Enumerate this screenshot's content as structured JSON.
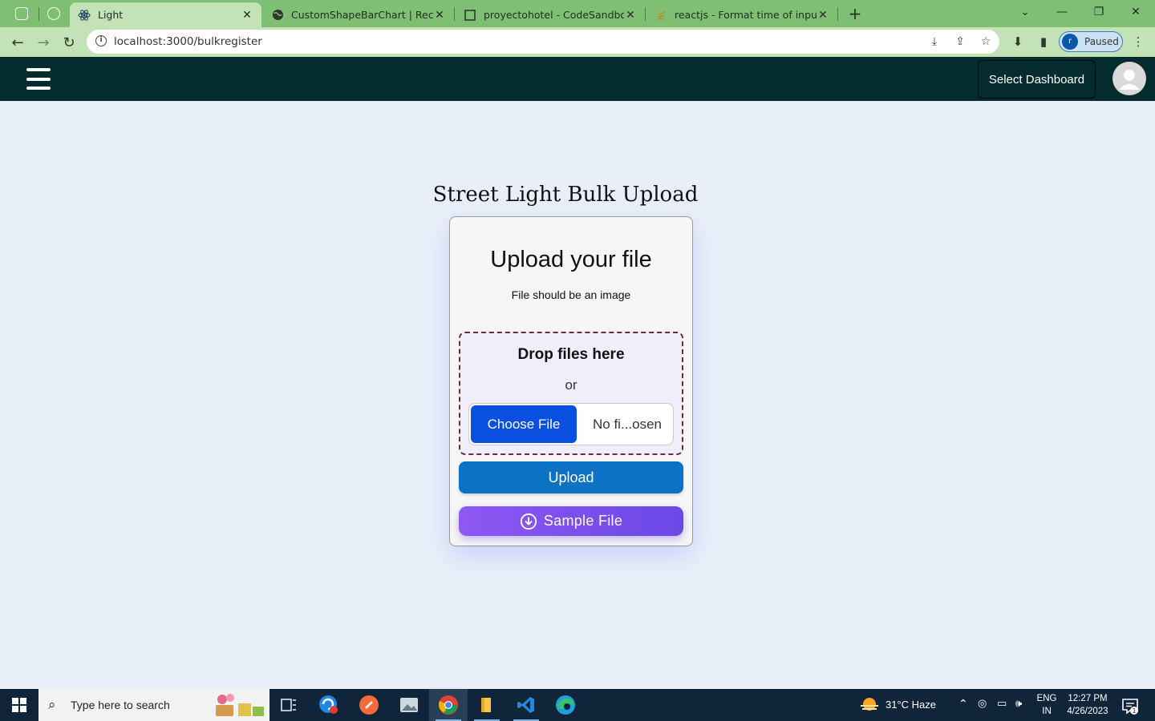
{
  "browser": {
    "tabs": [
      {
        "title": "Light",
        "active": true
      },
      {
        "title": "CustomShapeBarChart | Recharts",
        "active": false
      },
      {
        "title": "proyectohotel - CodeSandbox",
        "active": false
      },
      {
        "title": "reactjs - Format time of input typ",
        "active": false
      }
    ],
    "url": "localhost:3000/bulkregister",
    "profile_initial": "r",
    "profile_status": "Paused"
  },
  "header": {
    "select_dashboard_label": "Select Dashboard"
  },
  "main": {
    "page_title": "Street Light Bulk Upload",
    "card": {
      "title": "Upload your file",
      "subtitle": "File should be an image",
      "dropzone_title": "Drop files here",
      "or_label": "or",
      "choose_file_label": "Choose File",
      "no_file_label": "No fi...osen",
      "upload_label": "Upload",
      "sample_file_label": "Sample File"
    }
  },
  "taskbar": {
    "search_placeholder": "Type here to search",
    "weather": "31°C  Haze",
    "lang_line1": "ENG",
    "lang_line2": "IN",
    "time": "12:27 PM",
    "date": "4/26/2023",
    "notification_count": "1"
  },
  "colors": {
    "tabbar": "#7fbf74",
    "appbar": "#042c2e",
    "choose_button": "#0b4fe0",
    "upload_button": "#0b72c4",
    "sample_button": "#7a50ec",
    "dropzone_border": "#6a2b3e"
  },
  "icons": [
    "hamburger-icon",
    "user-avatar-icon",
    "download-cloud-icon",
    "windows-start-icon",
    "search-icon"
  ]
}
